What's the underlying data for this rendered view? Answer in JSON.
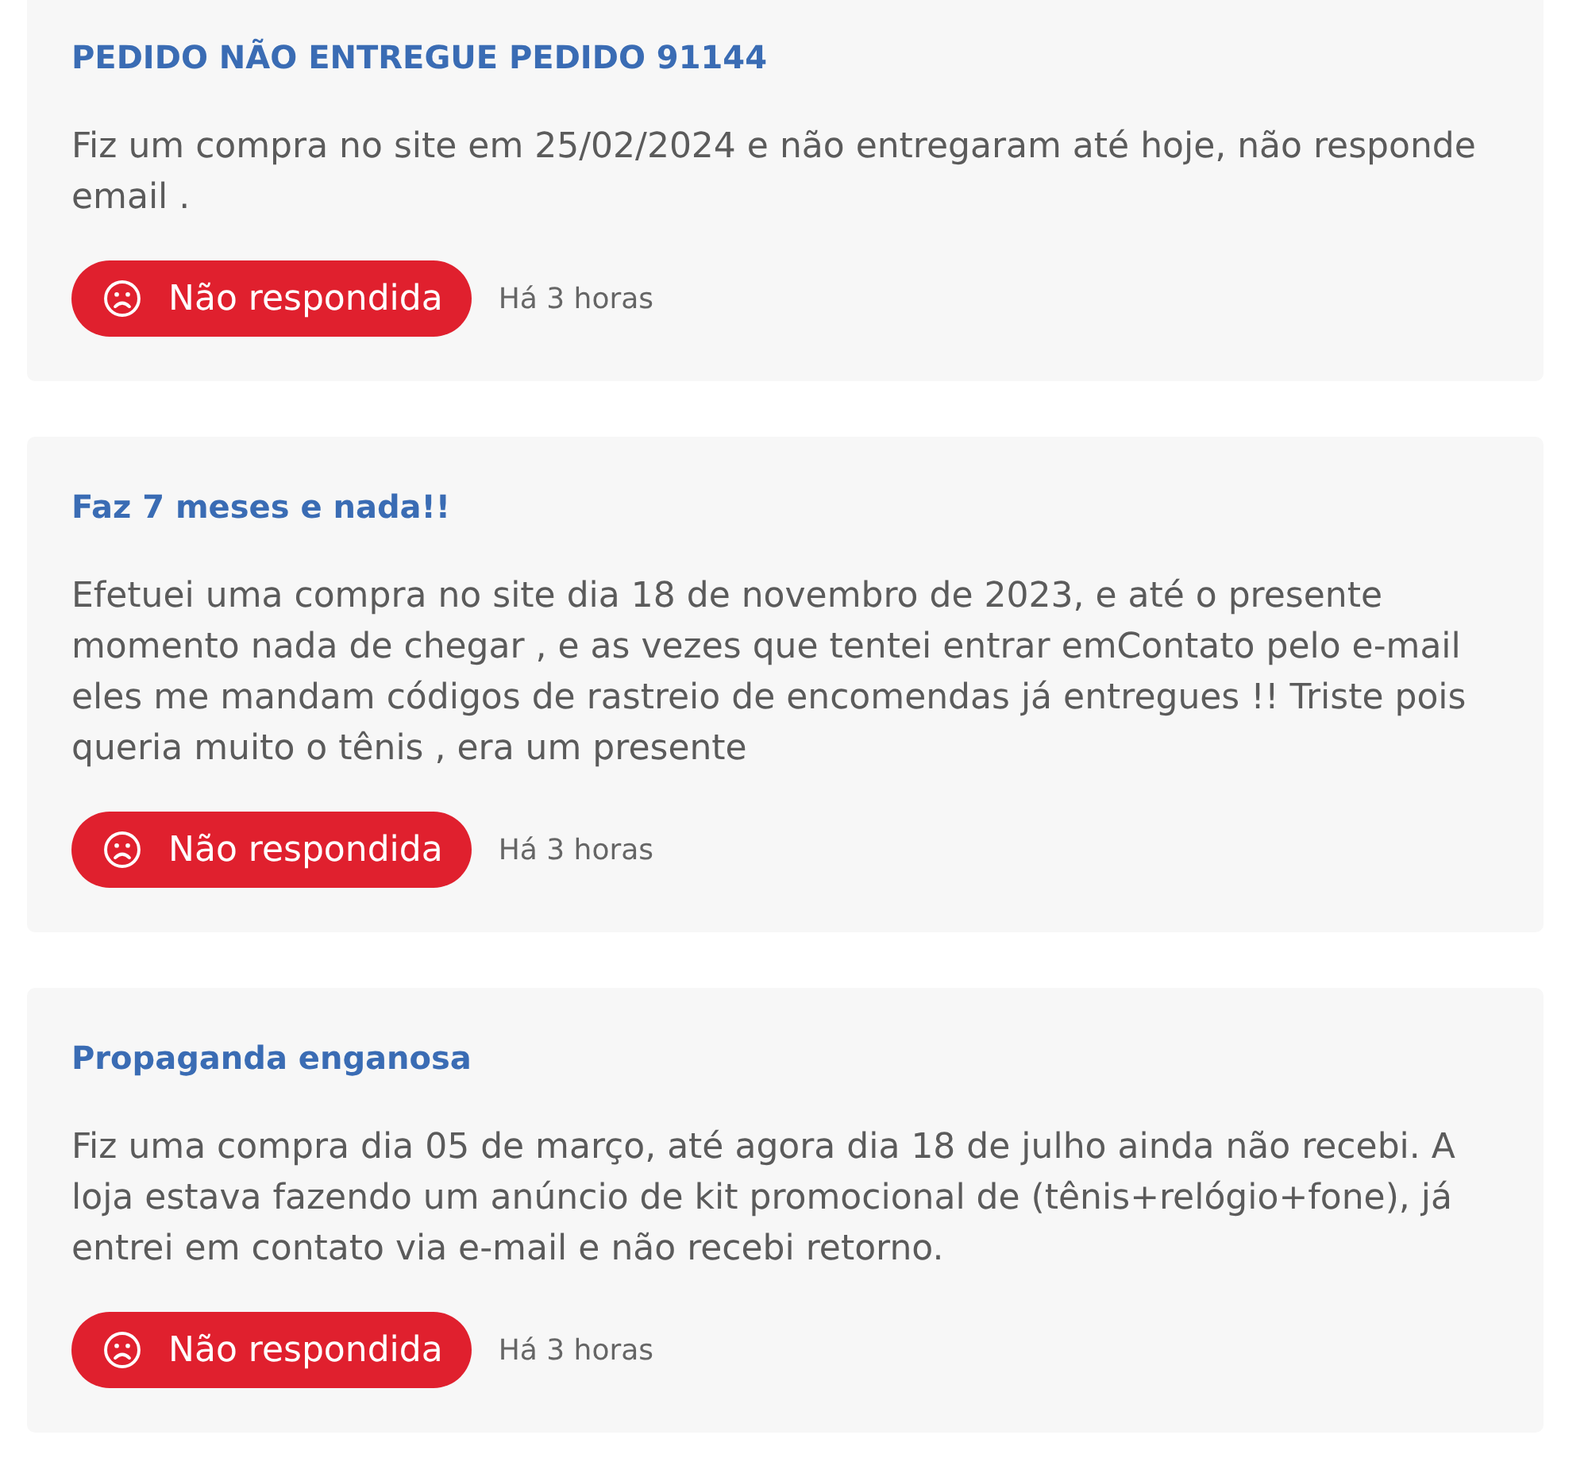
{
  "complaints": [
    {
      "title": "PEDIDO NÃO ENTREGUE PEDIDO 91144",
      "text": "Fiz um compra no site em 25/02/2024 e não entregaram até hoje, não responde email .",
      "status": {
        "kind": "unanswered",
        "label": "Não respondida"
      },
      "time": "Há 3 horas"
    },
    {
      "title": "Faz 7 meses e nada!!",
      "text": "Efetuei uma compra no site dia 18 de novembro de 2023, e até o presente momento nada de chegar , e as vezes que tentei entrar emContato pelo e-mail eles me mandam códigos de rastreio de encomendas já entregues !! Triste pois queria muito o tênis , era um presente",
      "status": {
        "kind": "unanswered",
        "label": "Não respondida"
      },
      "time": "Há 3 horas"
    },
    {
      "title": "Propaganda enganosa",
      "text": "Fiz uma compra dia 05 de março, até agora dia 18 de julho ainda não recebi. A loja estava fazendo um anúncio de kit promocional de (tênis+relógio+fone), já entrei em contato via e-mail e não recebi retorno.",
      "status": {
        "kind": "unanswered",
        "label": "Não respondida"
      },
      "time": "Há 3 horas"
    }
  ]
}
